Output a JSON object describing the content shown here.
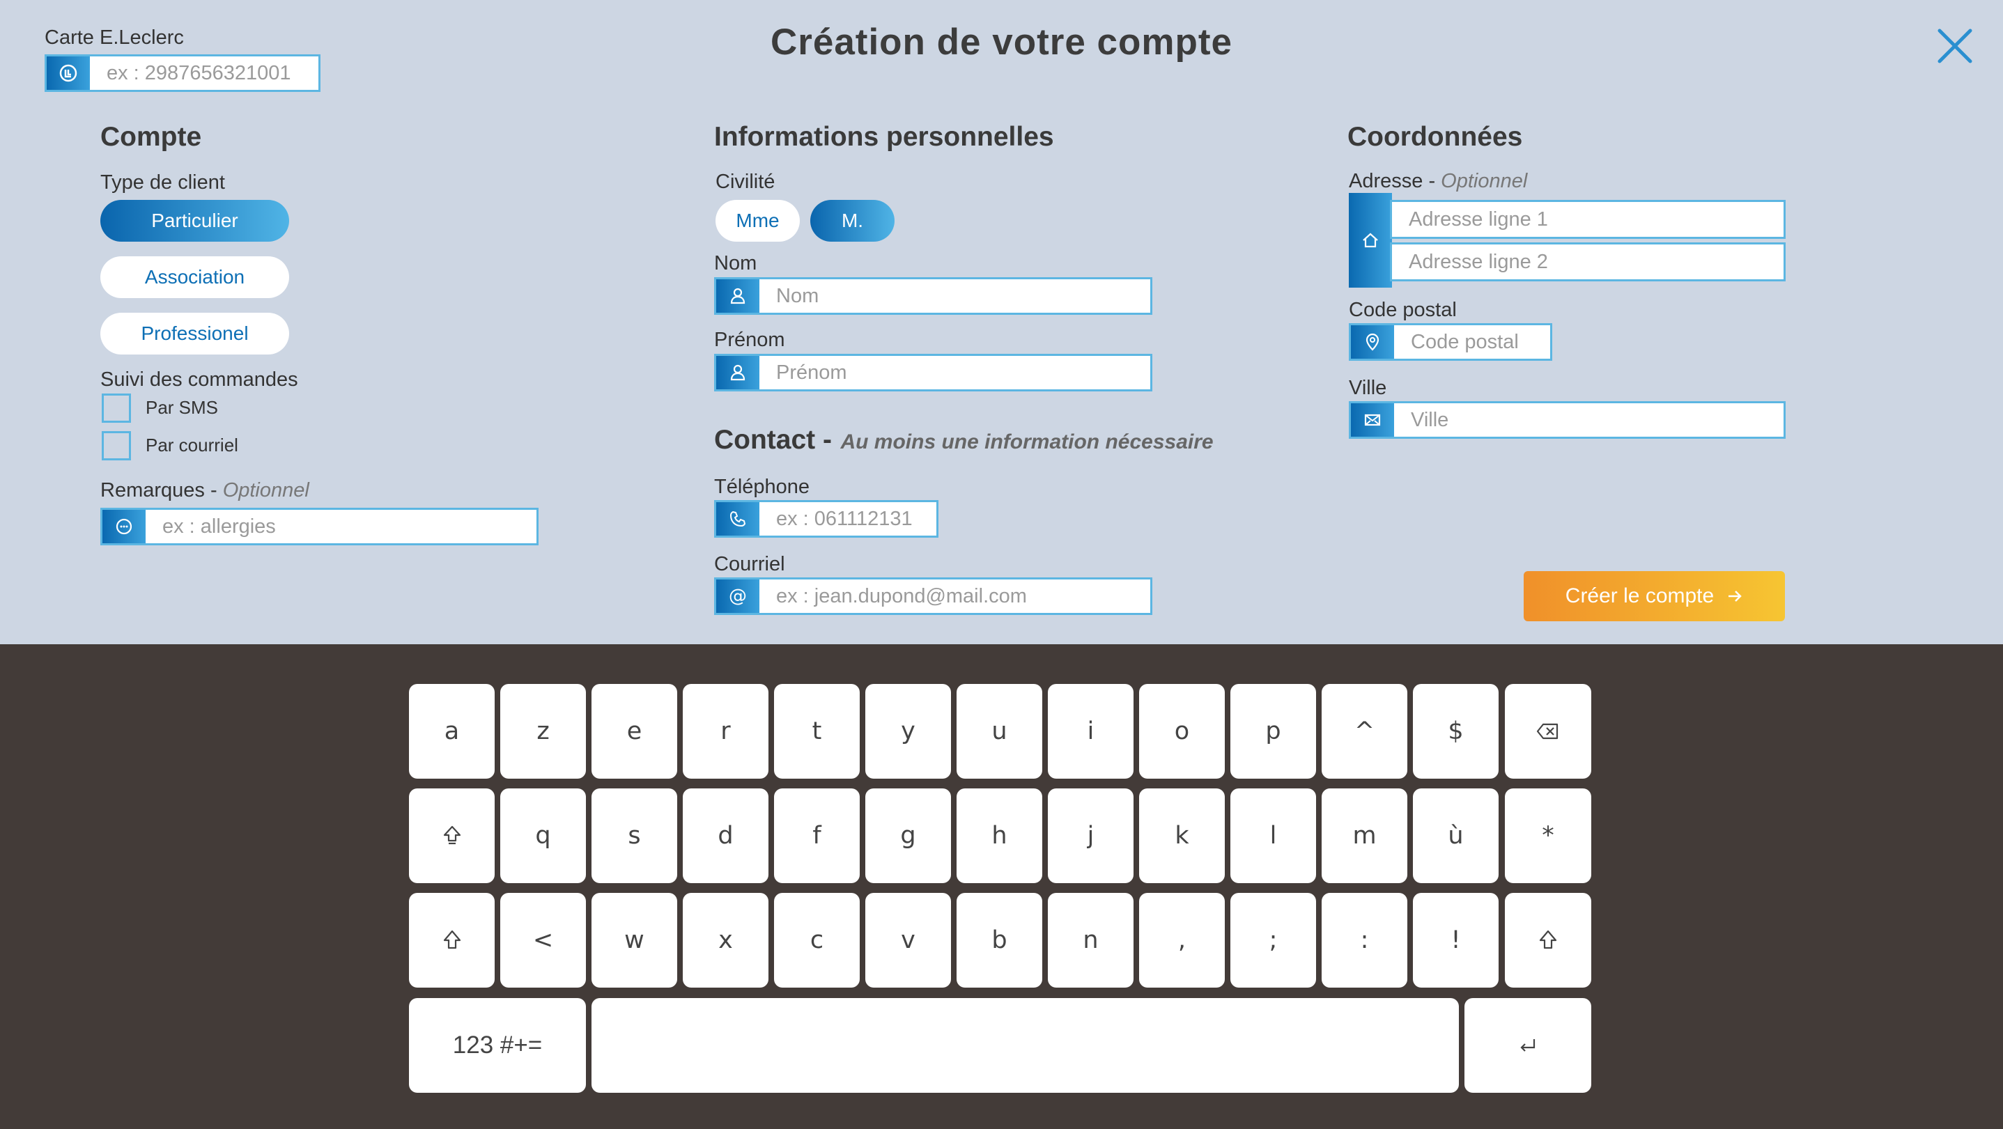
{
  "title": "Création de votre compte",
  "card": {
    "label": "Carte E.Leclerc",
    "placeholder": "ex : 2987656321001"
  },
  "compte": {
    "heading": "Compte",
    "type_label": "Type de client",
    "types": [
      "Particulier",
      "Association",
      "Professionel"
    ],
    "selected_type": "Particulier",
    "suivi_label": "Suivi des commandes",
    "suivi_options": [
      "Par SMS",
      "Par courriel"
    ],
    "remarques_label": "Remarques",
    "remarques_optional": "Optionnel",
    "remarques_placeholder": "ex : allergies"
  },
  "perso": {
    "heading": "Informations personnelles",
    "civilite_label": "Civilité",
    "civilites": [
      "Mme",
      "M."
    ],
    "selected_civilite": "M.",
    "nom_label": "Nom",
    "nom_placeholder": "Nom",
    "prenom_label": "Prénom",
    "prenom_placeholder": "Prénom"
  },
  "contact": {
    "heading": "Contact -",
    "subheading": "Au moins une information nécessaire",
    "tel_label": "Téléphone",
    "tel_placeholder": "ex : 061112131",
    "mail_label": "Courriel",
    "mail_placeholder": "ex : jean.dupond@mail.com"
  },
  "coord": {
    "heading": "Coordonnées",
    "adresse_label": "Adresse",
    "adresse_optional": "Optionnel",
    "adresse1_placeholder": "Adresse ligne 1",
    "adresse2_placeholder": "Adresse ligne 2",
    "cp_label": "Code postal",
    "cp_placeholder": "Code postal",
    "ville_label": "Ville",
    "ville_placeholder": "Ville"
  },
  "create_button": "Créer le compte",
  "keyboard": {
    "row1": [
      "a",
      "z",
      "e",
      "r",
      "t",
      "y",
      "u",
      "i",
      "o",
      "p",
      "^",
      "$"
    ],
    "row2": [
      "q",
      "s",
      "d",
      "f",
      "g",
      "h",
      "j",
      "k",
      "l",
      "m",
      "ù",
      "*"
    ],
    "row3": [
      "<",
      "w",
      "x",
      "c",
      "v",
      "b",
      "n",
      ",",
      ";",
      ":",
      "!"
    ],
    "symbols_key": "123 #+="
  },
  "colors": {
    "accent_blue": "#0d6fb5",
    "create_orange": "#f0902a",
    "keyboard_bg": "#433b38"
  }
}
